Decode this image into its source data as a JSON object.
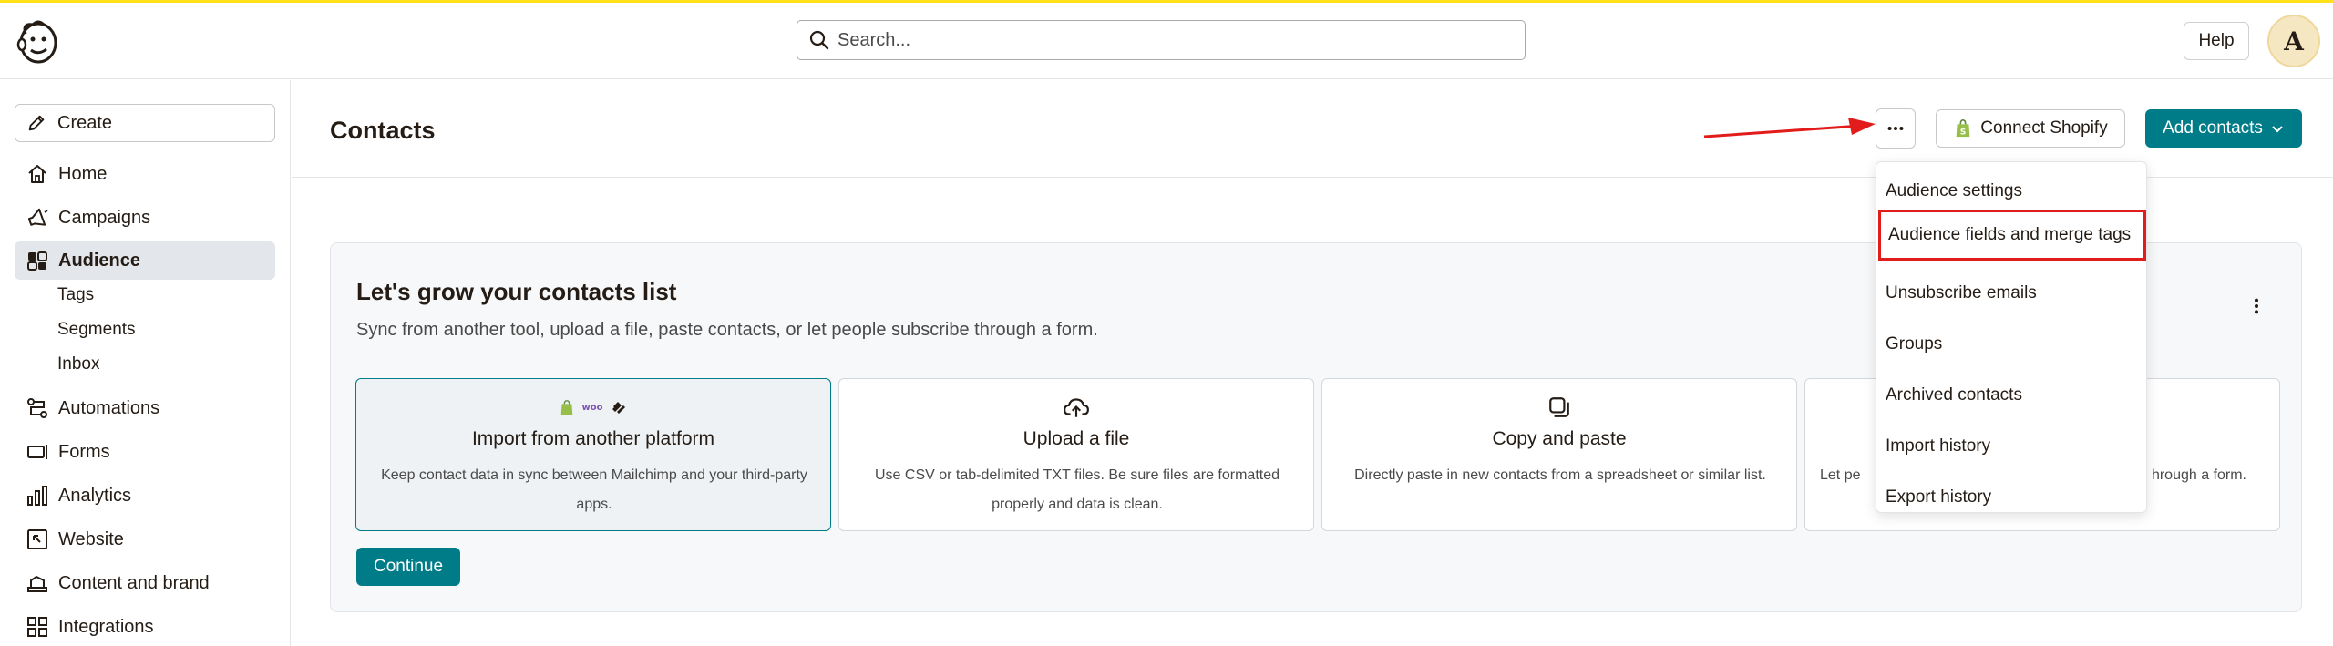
{
  "header": {
    "search_placeholder": "Search...",
    "help_label": "Help",
    "avatar_initial": "A",
    "accent_color": "#ffe01b"
  },
  "sidebar": {
    "create_label": "Create",
    "items": [
      {
        "label": "Home",
        "icon": "home-icon"
      },
      {
        "label": "Campaigns",
        "icon": "megaphone-icon"
      },
      {
        "label": "Audience",
        "icon": "audience-icon",
        "active": true
      },
      {
        "label": "Automations",
        "icon": "automations-icon"
      },
      {
        "label": "Forms",
        "icon": "forms-icon"
      },
      {
        "label": "Analytics",
        "icon": "analytics-icon"
      },
      {
        "label": "Website",
        "icon": "website-icon"
      },
      {
        "label": "Content and brand",
        "icon": "content-icon"
      },
      {
        "label": "Integrations",
        "icon": "integrations-icon"
      }
    ],
    "audience_subitems": [
      "Tags",
      "Segments",
      "Inbox"
    ]
  },
  "main": {
    "title": "Contacts",
    "connect_shopify_label": "Connect Shopify",
    "add_contacts_label": "Add contacts",
    "primary_color": "#007c89"
  },
  "dropdown": {
    "items": [
      "Audience settings",
      "Audience fields and merge tags",
      "Unsubscribe emails",
      "Groups",
      "Archived contacts",
      "Import history",
      "Export history"
    ],
    "highlighted_index": 1,
    "highlight_color": "#e21b1b"
  },
  "grow": {
    "title": "Let's grow your contacts list",
    "subtitle": "Sync from another tool, upload a file, paste contacts, or let people subscribe through a form.",
    "options": [
      {
        "title": "Import from another platform",
        "desc": "Keep contact data in sync between Mailchimp and your third-party apps.",
        "selected": true
      },
      {
        "title": "Upload a file",
        "desc": "Use CSV or tab-delimited TXT files. Be sure files are formatted properly and data is clean."
      },
      {
        "title": "Copy and paste",
        "desc": "Directly paste in new contacts from a spreadsheet or similar list."
      },
      {
        "desc_left": "Let pe",
        "desc_right": "hrough a form."
      }
    ],
    "woo_label": "woo",
    "continue_label": "Continue"
  }
}
